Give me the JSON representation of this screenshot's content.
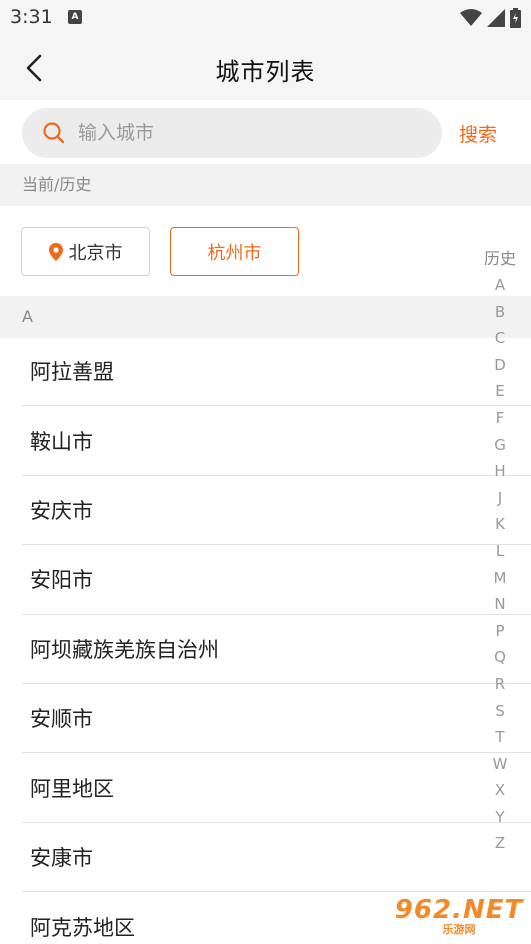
{
  "status_bar": {
    "time": "3:31",
    "notification_glyph": "A"
  },
  "header": {
    "title": "城市列表"
  },
  "search": {
    "placeholder": "输入城市",
    "value": "",
    "button_label": "搜索"
  },
  "sections": {
    "recent_header": "当前/历史",
    "a_header": "A"
  },
  "recent": {
    "current_city": "北京市",
    "history_city": "杭州市"
  },
  "cities": [
    "阿拉善盟",
    "鞍山市",
    "安庆市",
    "安阳市",
    "阿坝藏族羌族自治州",
    "安顺市",
    "阿里地区",
    "安康市",
    "阿克苏地区"
  ],
  "index_bar": {
    "history_label": "历史",
    "letters": [
      "A",
      "B",
      "C",
      "D",
      "E",
      "F",
      "G",
      "H",
      "J",
      "K",
      "L",
      "M",
      "N",
      "P",
      "Q",
      "R",
      "S",
      "T",
      "W",
      "X",
      "Y",
      "Z"
    ]
  },
  "watermark": {
    "main": "962.NET",
    "sub": "乐游网"
  },
  "colors": {
    "accent": "#f06a1c",
    "section_bg": "#f2f2f2",
    "search_bg": "#ececec"
  },
  "icons": {
    "back": "chevron-left-icon",
    "search": "search-icon",
    "location": "location-pin-icon"
  }
}
